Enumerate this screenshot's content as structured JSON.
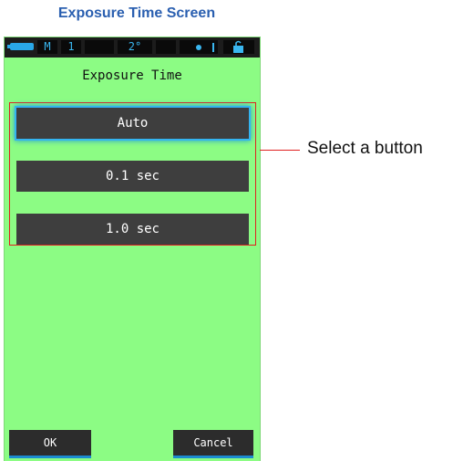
{
  "caption": "Exposure Time Screen",
  "status_bar": {
    "mode": "M",
    "memory": "1",
    "angle": "2°"
  },
  "screen": {
    "title": "Exposure Time",
    "options": [
      "Auto",
      "0.1 sec",
      "1.0 sec"
    ],
    "selected_option": "Auto",
    "ok_label": "OK",
    "cancel_label": "Cancel"
  },
  "annotation": {
    "text": "Select a button"
  },
  "colors": {
    "screen_background": "#8cfc84",
    "button": "#3e3e3e",
    "selection_glow": "#34b4f0",
    "highlight_box": "#e02020",
    "caption": "#2a5fb0"
  }
}
